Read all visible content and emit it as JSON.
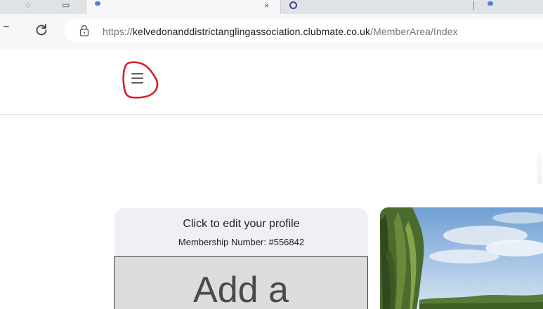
{
  "browser": {
    "url": {
      "scheme": "https://",
      "host": "kelvedonanddistrictanglingassociation.clubmate.co.uk",
      "path": "/MemberArea/Index"
    },
    "tab_close_glyph": "×",
    "icons": {
      "back": "back-arrow-icon",
      "reload": "reload-icon",
      "site_info": "site-info-icon"
    }
  },
  "header": {
    "menu_icon": "hamburger-menu-icon",
    "annotation_color": "#d81f26"
  },
  "profile": {
    "title": "Click to edit your profile",
    "membership_number": "Membership Number: #556842",
    "photo_label": "Add a"
  },
  "colors": {
    "card_background": "#eff0f3",
    "photo_placeholder": "#dcdcdc",
    "annotation_red": "#d81f26"
  }
}
